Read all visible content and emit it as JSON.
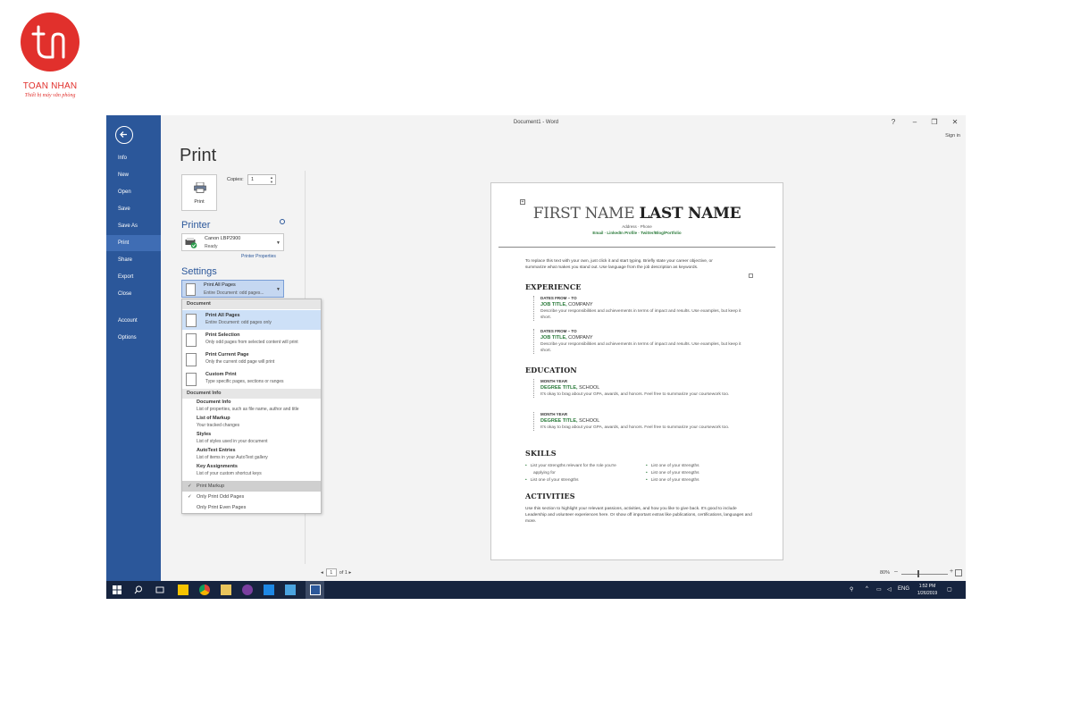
{
  "logo": {
    "title": "TOAN NHAN",
    "subtitle": "Thiết bị máy văn phòng",
    "brand_color": "#e1302c"
  },
  "window": {
    "title": "Document1 - Word",
    "sign_in": "Sign in",
    "help": "?",
    "minimize": "–",
    "restore": "❐",
    "close": "✕"
  },
  "nav": {
    "items": [
      "Info",
      "New",
      "Open",
      "Save",
      "Save As",
      "Print",
      "Share",
      "Export",
      "Close",
      "Account",
      "Options"
    ],
    "active": "Print",
    "color": "#2b579a"
  },
  "print": {
    "heading": "Print",
    "button_label": "Print",
    "copies_label": "Copies:",
    "copies_value": "1"
  },
  "printer": {
    "heading": "Printer",
    "name": "Canon LBP2900",
    "status": "Ready",
    "properties_link": "Printer Properties"
  },
  "settings": {
    "heading": "Settings",
    "selected_title": "Print All Pages",
    "selected_sub": "Entire Document: odd pages..."
  },
  "dropdown": {
    "group_document": "Document",
    "items": [
      {
        "title": "Print All Pages",
        "sub": "Entire Document: odd pages only"
      },
      {
        "title": "Print Selection",
        "sub": "Only odd pages from selected content will print"
      },
      {
        "title": "Print Current Page",
        "sub": "Only the current odd page will print"
      },
      {
        "title": "Custom Print",
        "sub": "Type specific pages, sections or ranges"
      }
    ],
    "group_info": "Document Info",
    "info_items": [
      {
        "title": "Document Info",
        "sub": "List of properties, such as file name, author and title"
      },
      {
        "title": "List of Markup",
        "sub": "Your tracked changes"
      },
      {
        "title": "Styles",
        "sub": "List of styles used in your document"
      },
      {
        "title": "AutoText Entries",
        "sub": "List of items in your AutoText gallery"
      },
      {
        "title": "Key Assignments",
        "sub": "List of your custom shortcut keys"
      }
    ],
    "options": [
      {
        "label": "Print Markup",
        "checked": "✓"
      },
      {
        "label": "Only Print Odd Pages",
        "checked": "✓"
      },
      {
        "label": "Only Print Even Pages",
        "checked": ""
      }
    ]
  },
  "preview": {
    "first": "FIRST NAME ",
    "last": "LAST NAME",
    "contact": "Address · Phone",
    "links": "Email · LinkedIn Profile · Twitter/Blog/Portfolio",
    "objective": "To replace this text with your own, just click it and start typing. Briefly state your career objective, or summarize what makes you stand out. Use language from the job description as keywords.",
    "experience_h": "EXPERIENCE",
    "experience": [
      {
        "dates": "DATES FROM – TO",
        "title": "JOB TITLE,",
        "org": " COMPANY",
        "desc": "Describe your responsibilities and achievements in terms of impact and results. Use examples, but keep it short."
      },
      {
        "dates": "DATES FROM – TO",
        "title": "JOB TITLE,",
        "org": " COMPANY",
        "desc": "Describe your responsibilities and achievements in terms of impact and results. Use examples, but keep it short."
      }
    ],
    "education_h": "EDUCATION",
    "education": [
      {
        "dates": "MONTH YEAR",
        "title": "DEGREE TITLE,",
        "org": " SCHOOL",
        "desc": "It's okay to brag about your GPA, awards, and honors. Feel free to summarize your coursework too."
      },
      {
        "dates": "MONTH YEAR",
        "title": "DEGREE TITLE,",
        "org": " SCHOOL",
        "desc": "It's okay to brag about your GPA, awards, and honors. Feel free to summarize your coursework too."
      }
    ],
    "skills_h": "SKILLS",
    "skills_left": [
      "List your strengths relevant for the role you're",
      "applying for",
      "List one of your strengths"
    ],
    "skills_right": [
      "List one of your strengths",
      "List one of your strengths",
      "List one of your strengths"
    ],
    "activities_h": "ACTIVITIES",
    "activities": "Use this section to highlight your relevant passions, activities, and how you like to give back. It's good to include Leadership and volunteer experiences here. Or show off important extras like publications, certifications, languages and more."
  },
  "status": {
    "page_value": "1",
    "page_of": "of 1",
    "prev": "◂",
    "next": "▸",
    "zoom": "80%"
  },
  "taskbar": {
    "lang": "ENG",
    "time": "1:52 PM",
    "date": "1/26/2019"
  }
}
